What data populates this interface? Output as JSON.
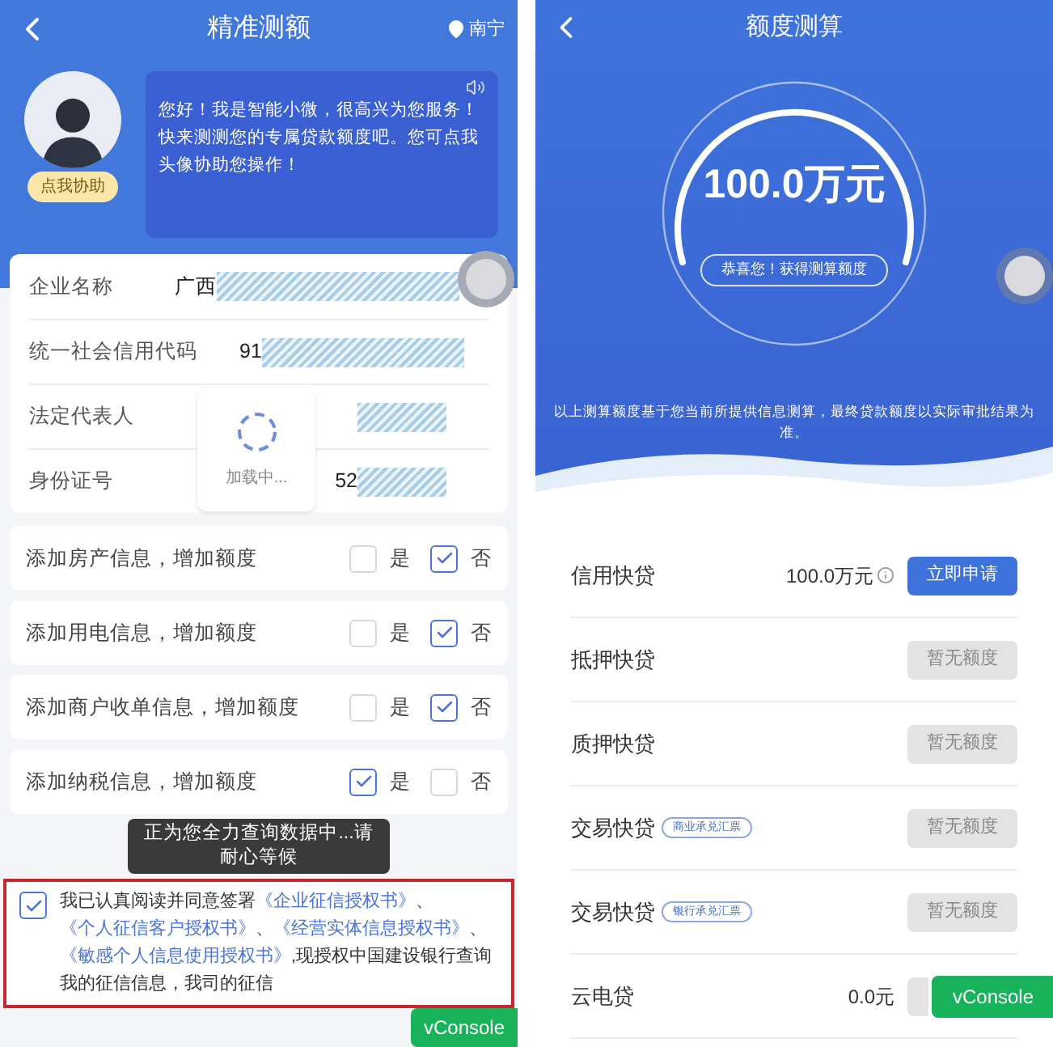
{
  "left": {
    "header": {
      "title": "精准测额",
      "location": "南宁"
    },
    "assistant": {
      "badge": "点我协助",
      "message": "您好！我是智能小微，很高兴为您服务！快来测测您的专属贷款额度吧。您可点我头像协助您操作！"
    },
    "info_fields": [
      {
        "label": "企业名称",
        "value": "广西",
        "redacted": true
      },
      {
        "label": "统一社会信用代码",
        "value": "91",
        "redacted": true
      },
      {
        "label": "法定代表人",
        "redacted": true
      },
      {
        "label": "身份证号",
        "value": "52",
        "redacted": true
      }
    ],
    "options": [
      {
        "label": "添加房产信息，增加额度",
        "choices": [
          {
            "label": "是",
            "checked": false
          },
          {
            "label": "否",
            "checked": true
          }
        ]
      },
      {
        "label": "添加用电信息，增加额度",
        "choices": [
          {
            "label": "是",
            "checked": false
          },
          {
            "label": "否",
            "checked": true
          }
        ]
      },
      {
        "label": "添加商户收单信息，增加额度",
        "choices": [
          {
            "label": "是",
            "checked": false
          },
          {
            "label": "否",
            "checked": true
          }
        ]
      },
      {
        "label": "添加纳税信息，增加额度",
        "choices": [
          {
            "label": "是",
            "checked": true
          },
          {
            "label": "否",
            "checked": false
          }
        ]
      }
    ],
    "consent": {
      "checked": true,
      "parts": [
        {
          "kind": "text",
          "text": "我已认真阅读并同意签署"
        },
        {
          "kind": "link",
          "text": "《企业征信授权书》"
        },
        {
          "kind": "text",
          "text": "、"
        },
        {
          "kind": "link",
          "text": "《个人征信客户授权书》"
        },
        {
          "kind": "text",
          "text": "、"
        },
        {
          "kind": "link",
          "text": "《经营实体信息授权书》"
        },
        {
          "kind": "text",
          "text": "、"
        },
        {
          "kind": "link",
          "text": "《敏感个人信息使用授权书》"
        },
        {
          "kind": "text",
          "text": ",现授权中国建设银行查询我的征信信息，我司的征信"
        }
      ]
    },
    "loading": {
      "text": "加载中..."
    },
    "toast": {
      "text": "正为您全力查询数据中...请耐心等候"
    },
    "debug_button": "vConsole"
  },
  "right": {
    "header": {
      "title": "额度测算"
    },
    "result": {
      "amount": "100.0万元",
      "congrats": "恭喜您！获得测算额度",
      "disclaimer": "以上测算额度基于您当前所提供信息测算，最终贷款额度以实际审批结果为准。"
    },
    "products": [
      {
        "name": "信用快贷",
        "amount": "100.0万元",
        "info": true,
        "button": {
          "kind": "apply",
          "label": "立即申请"
        }
      },
      {
        "name": "抵押快贷",
        "button": {
          "kind": "disabled",
          "label": "暂无额度"
        }
      },
      {
        "name": "质押快贷",
        "button": {
          "kind": "disabled",
          "label": "暂无额度"
        }
      },
      {
        "name": "交易快贷",
        "tag": "商业承兑汇票",
        "button": {
          "kind": "disabled",
          "label": "暂无额度"
        }
      },
      {
        "name": "交易快贷",
        "tag": "银行承兑汇票",
        "button": {
          "kind": "disabled",
          "label": "暂无额度"
        }
      },
      {
        "name": "云电贷",
        "amount": "0.0元",
        "button": {
          "kind": "covered"
        }
      }
    ],
    "debug_button": "vConsole"
  }
}
